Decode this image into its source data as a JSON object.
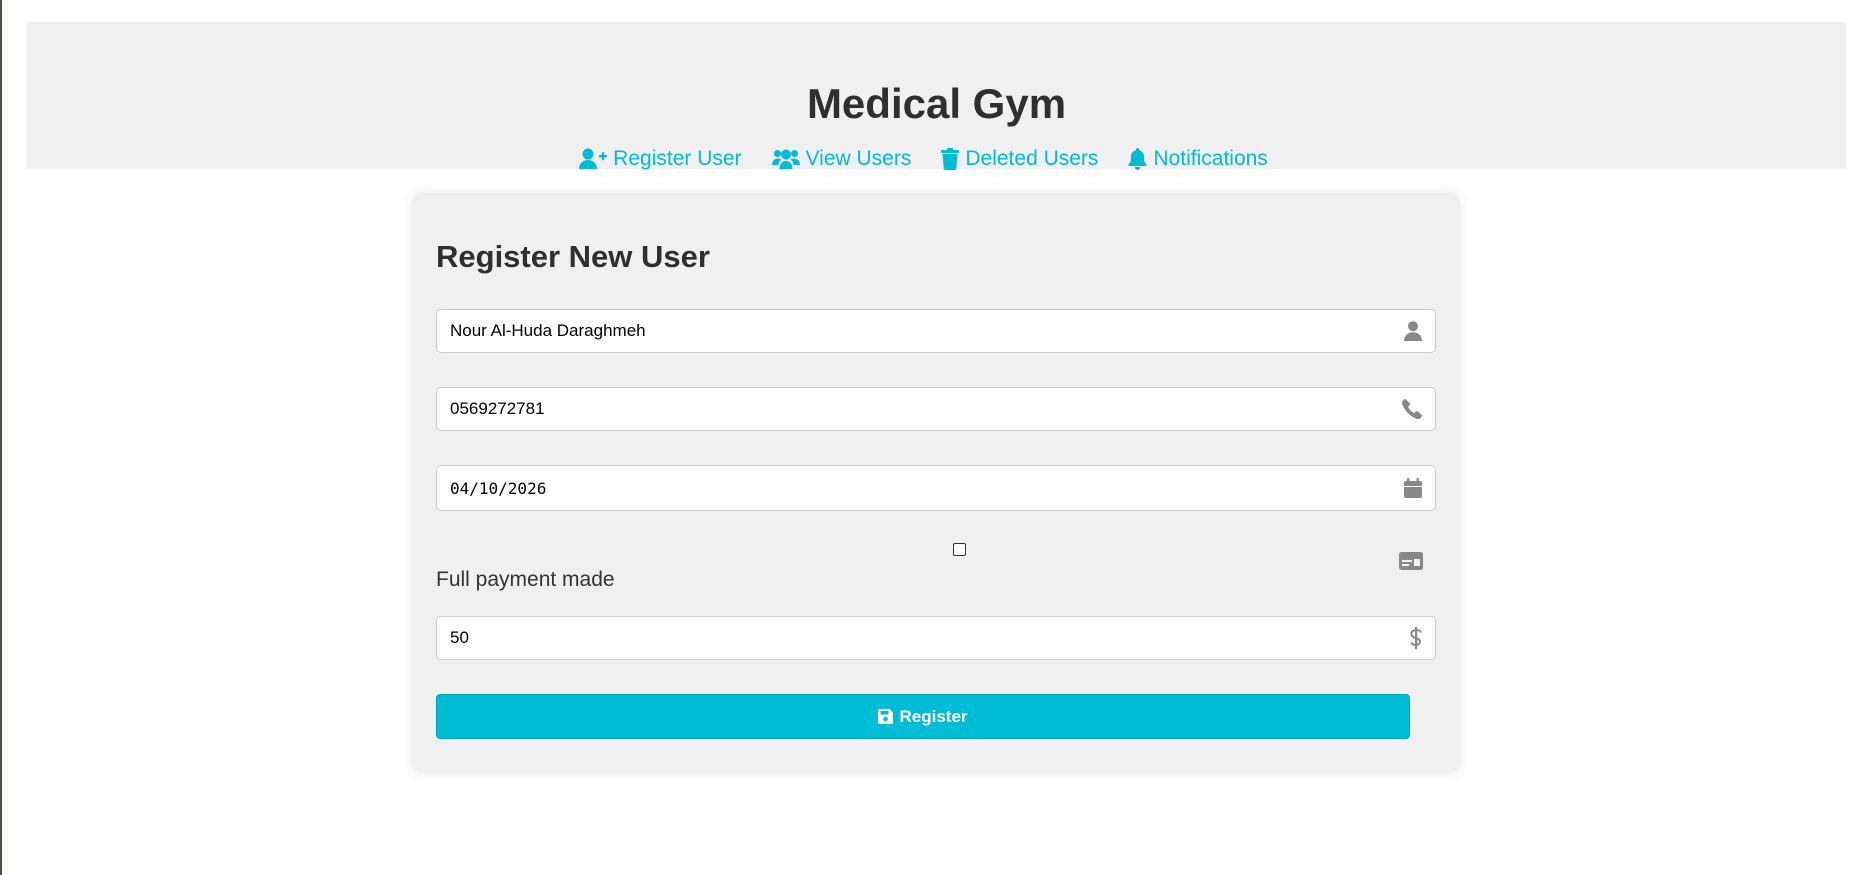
{
  "header": {
    "title": "Medical Gym",
    "nav": [
      {
        "label": "Register User",
        "icon": "user-plus-icon"
      },
      {
        "label": "View Users",
        "icon": "users-icon"
      },
      {
        "label": "Deleted Users",
        "icon": "trash-icon"
      },
      {
        "label": "Notifications",
        "icon": "bell-icon"
      }
    ]
  },
  "form": {
    "title": "Register New User",
    "name_value": "Nour Al-Huda Daraghmeh",
    "phone_value": "0569272781",
    "date_value": "04/10/2026",
    "full_payment_label": "Full payment made",
    "full_payment_checked": false,
    "amount_value": "50",
    "submit_label": "Register"
  },
  "colors": {
    "accent": "#00bcd4",
    "header_bg": "#f0f0f0",
    "card_bg": "#f0f0f0",
    "icon_gray": "#888888",
    "text": "#333333"
  }
}
